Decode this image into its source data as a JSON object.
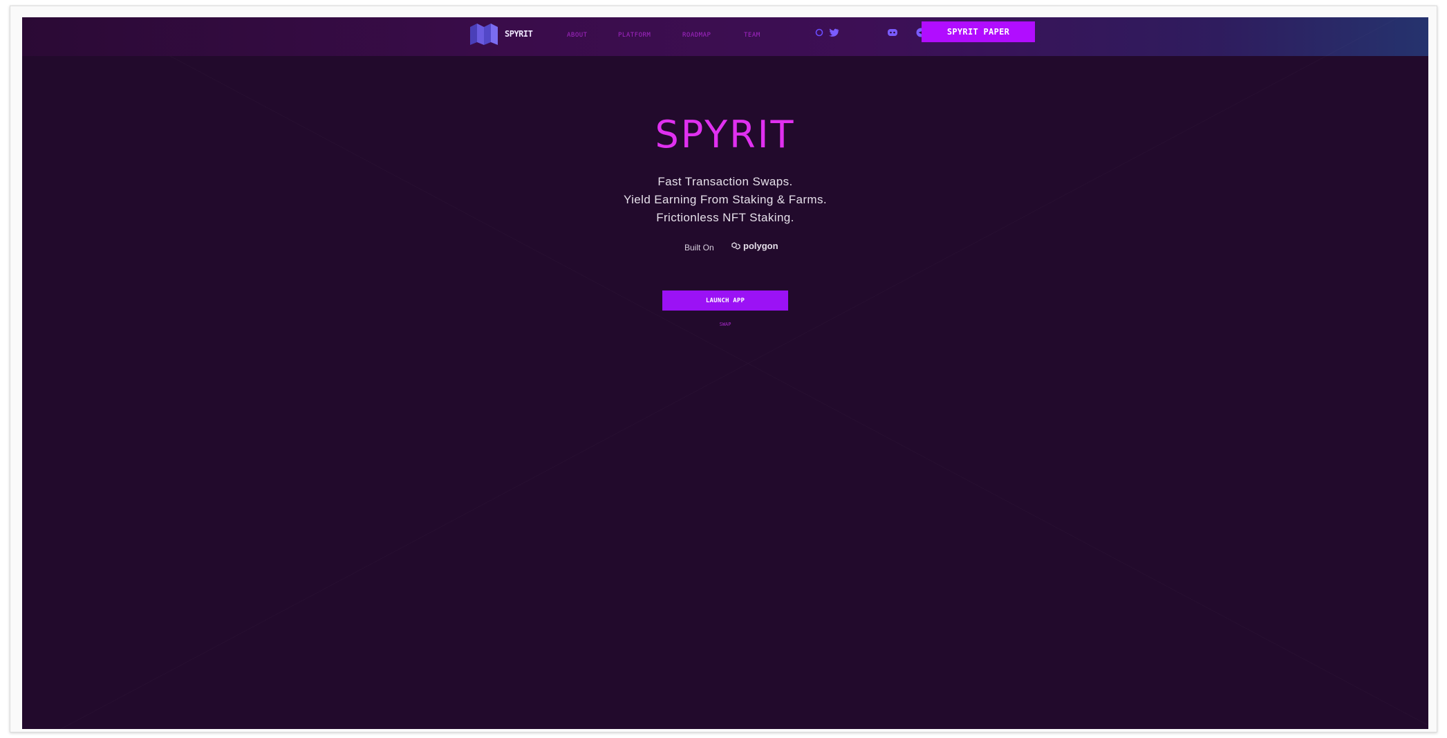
{
  "brand": {
    "name": "SPYRIT"
  },
  "nav": {
    "links": [
      "ABOUT",
      "PLATFORM",
      "ROADMAP",
      "TEAM"
    ],
    "social_icons": [
      "github-icon",
      "twitter-icon",
      "discord-icon",
      "telegram-icon"
    ],
    "paper_button": "SPYRIT PAPER"
  },
  "hero": {
    "title": "SPYRIT",
    "taglines": [
      "Fast Transaction Swaps.",
      "Yield Earning From Staking & Farms.",
      "Frictionless NFT Staking."
    ],
    "built_on_label": "Built On",
    "platform_name": "polygon",
    "launch_button": "LAUNCH APP",
    "secondary_link": "SWAP"
  },
  "colors": {
    "background": "#220a2c",
    "accent": "#b10dff",
    "title": "#e030f0",
    "nav_link": "#c82ff0"
  }
}
